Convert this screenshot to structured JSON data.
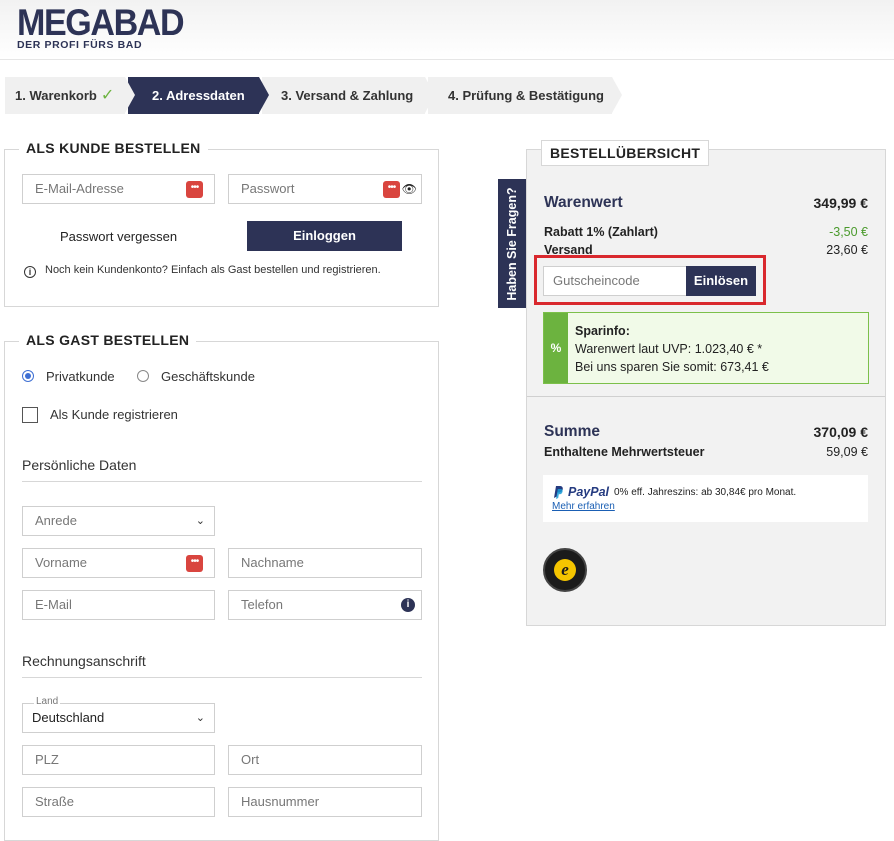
{
  "header": {
    "logo_main": "MEGABAD",
    "logo_sub": "DER PROFI FÜRS BAD"
  },
  "steps": [
    {
      "label": "1. Warenkorb",
      "done": true
    },
    {
      "label": "2. Adressdaten",
      "active": true
    },
    {
      "label": "3. Versand & Zahlung"
    },
    {
      "label": "4. Prüfung & Bestätigung"
    }
  ],
  "login": {
    "title": "ALS KUNDE BESTELLEN",
    "email_placeholder": "E-Mail-Adresse",
    "password_placeholder": "Passwort",
    "forgot_link": "Passwort vergessen",
    "login_button": "Einloggen",
    "info": "Noch kein Kundenkonto? Einfach als Gast bestellen und registrieren."
  },
  "guest": {
    "title": "ALS GAST BESTELLEN",
    "radio_private": "Privatkunde",
    "radio_business": "Geschäftskunde",
    "register_checkbox": "Als Kunde registrieren",
    "personal_title": "Persönliche Daten",
    "anrede": "Anrede",
    "vorname": "Vorname",
    "nachname": "Nachname",
    "email": "E-Mail",
    "telefon": "Telefon",
    "billing_title": "Rechnungsanschrift",
    "land_label": "Land",
    "land_value": "Deutschland",
    "plz": "PLZ",
    "ort": "Ort",
    "strasse": "Straße",
    "hausnummer": "Hausnummer"
  },
  "side_tab": "Haben Sie Fragen?",
  "summary": {
    "title": "BESTELLÜBERSICHT",
    "warenwert_label": "Warenwert",
    "warenwert_value": "349,99 €",
    "rabatt_label": "Rabatt 1% (Zahlart)",
    "rabatt_value": "-3,50 €",
    "versand_label": "Versand",
    "versand_value": "23,60 €",
    "voucher_placeholder": "Gutscheincode",
    "voucher_button": "Einlösen",
    "sparinfo_title": "Sparinfo:",
    "sparinfo_line1": "Warenwert laut UVP: 1.023,40 € *",
    "sparinfo_line2": "Bei uns sparen Sie somit: 673,41 €",
    "sparinfo_icon": "%",
    "summe_label": "Summe",
    "summe_value": "370,09 €",
    "mwst_label": "Enthaltene Mehrwertsteuer",
    "mwst_value": "59,09 €",
    "paypal_brand": "PayPal",
    "paypal_text": "0% eff. Jahreszins: ab 30,84€ pro Monat.",
    "paypal_link": "Mehr erfahren"
  },
  "colors": {
    "primary": "#2d3356",
    "accent_green": "#6cb33f",
    "highlight": "#d9282e"
  }
}
